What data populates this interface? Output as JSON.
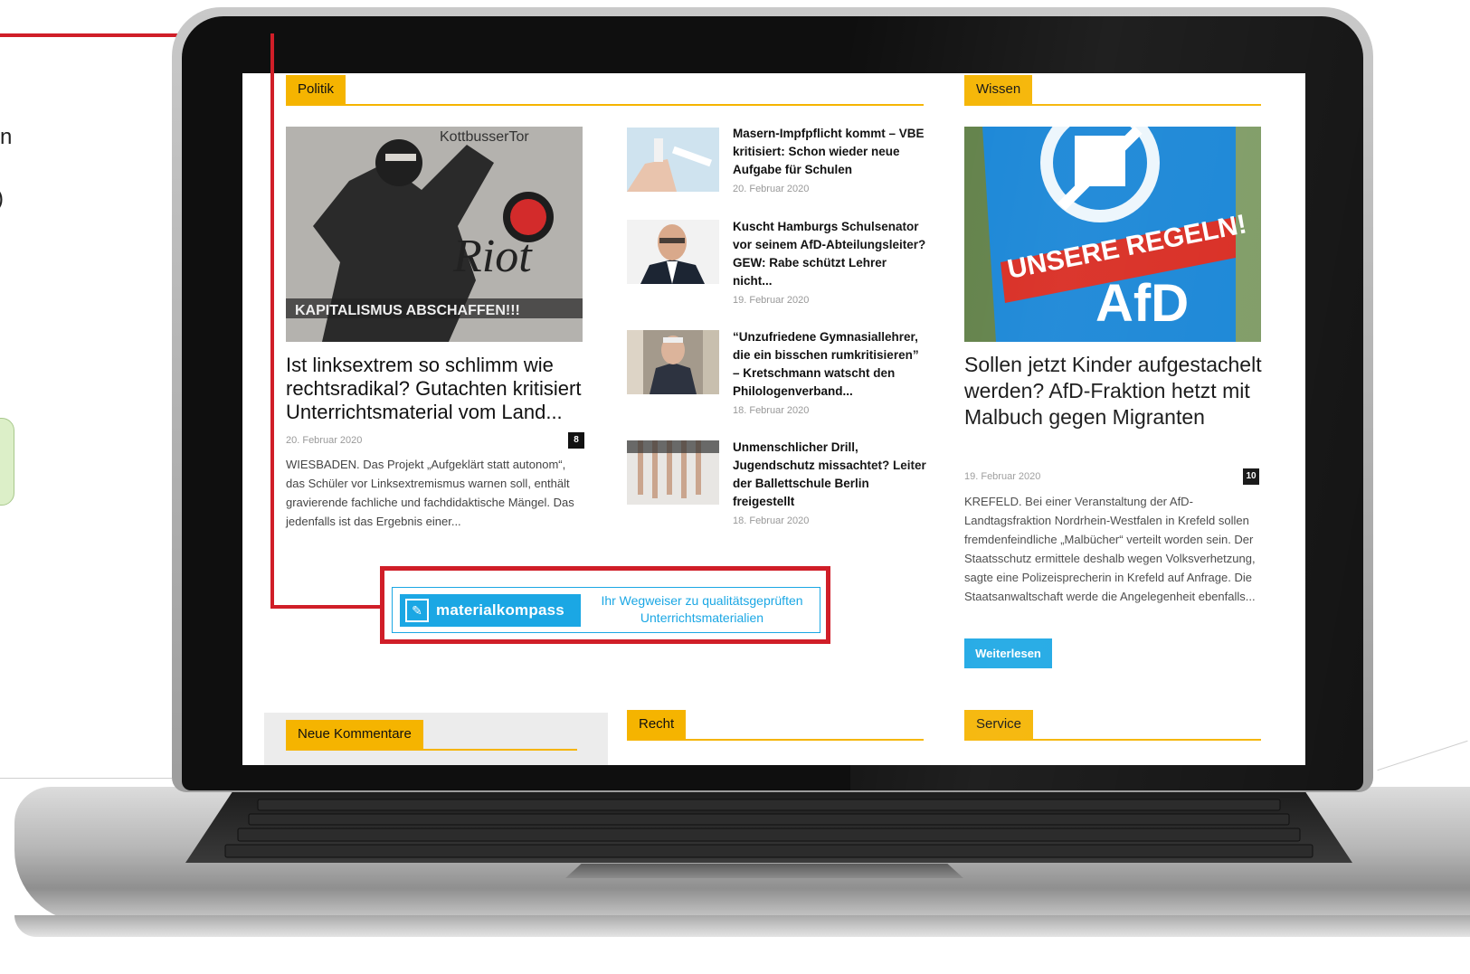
{
  "politik": {
    "section_label": "Politik",
    "lead": {
      "title": "Ist linksextrem so schlimm wie rechtsradikal? Gutachten kritisiert Unterrichtsmaterial vom Land...",
      "date": "20. Februar 2020",
      "comments": "8",
      "excerpt": "WIESBADEN. Das Projekt „Aufgeklärt statt autonom“, das Schüler vor Linksextremismus warnen soll, enthält gravierende fachliche und fachdidaktische Mängel. Das jedenfalls ist das Ergebnis einer...",
      "image_text_top": "KottbusserTor",
      "image_text_script": "Riot",
      "image_text_bottom": "KAPITALISMUS ABSCHAFFEN!!!"
    },
    "articles": [
      {
        "title": "Masern-Impfpflicht kommt – VBE kritisiert: Schon wieder neue Aufgabe für Schulen",
        "date": "20. Februar 2020"
      },
      {
        "title": "Kuscht Hamburgs Schulsenator vor seinem AfD-Abteilungsleiter? GEW: Rabe schützt Lehrer nicht...",
        "date": "19. Februar 2020"
      },
      {
        "title": "“Unzufriedene Gymnasiallehrer, die ein bisschen rumkritisieren” – Kretschmann watscht den Philologenverband...",
        "date": "18. Februar 2020"
      },
      {
        "title": "Unmenschlicher Drill, Jugendschutz missachtet? Leiter der Ballettschule Berlin freigestellt",
        "date": "18. Februar 2020"
      }
    ]
  },
  "wissen": {
    "section_label": "Wissen",
    "lead": {
      "title": "Sollen jetzt Kinder aufgestachelt werden? AfD-Fraktion hetzt mit Malbuch gegen Migranten",
      "date": "19. Februar 2020",
      "comments": "10",
      "excerpt": "KREFELD. Bei einer Veranstaltung der AfD-Landtagsfraktion Nordrhein-Westfalen in Krefeld sollen fremdenfeindliche „Malbücher“ verteilt worden sein. Der Staatsschutz ermittele deshalb wegen Volksverhetzung, sagte eine Polizeisprecherin in Krefeld auf Anfrage. Die Staatsanwaltschaft werde die Angelegenheit ebenfalls...",
      "read_more": "Weiterlesen",
      "image_text_slogan": "UNSERE REGELN!",
      "image_text_party": "AfD"
    }
  },
  "banner": {
    "logo_text": "materialkompass",
    "claim": "Ihr Wegweiser zu qualitätsgeprüften Unterrichtsmaterialien"
  },
  "bottom_sections": {
    "comments_label": "Neue Kommentare",
    "recht_label": "Recht",
    "service_label": "Service"
  },
  "colors": {
    "section_accent": "#f5b400",
    "button_blue": "#1ba7e4",
    "callout_red": "#d01e28"
  },
  "icons": {
    "banner_logo": "compass-pen-icon"
  }
}
